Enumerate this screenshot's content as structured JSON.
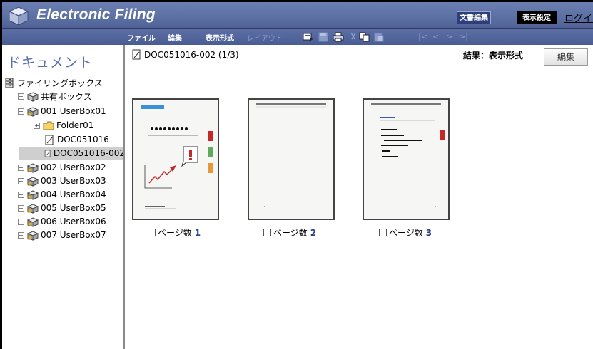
{
  "header": {
    "title": "Electronic Filing",
    "edit_doc_button": "文書編集",
    "view_settings_button": "表示設定",
    "login_link": "ログイン"
  },
  "menu": {
    "file": "ファイル",
    "edit": "編集",
    "display_format": "表示形式",
    "layout": "レイアウト"
  },
  "sidebar": {
    "title": "ドキュメント",
    "root": "ファイリングボックス",
    "shared_box": "共有ボックス",
    "box01": "001 UserBox01",
    "folder01": "Folder01",
    "doc1": "DOC051016",
    "doc2": "DOC051016-002",
    "box02": "002 UserBox02",
    "box03": "003 UserBox03",
    "box04": "004 UserBox04",
    "box05": "005 UserBox05",
    "box06": "006 UserBox06",
    "box07": "007 UserBox07"
  },
  "main": {
    "doc_title": "DOC051016-002  (1/3)",
    "result_label": "結果：表示形式",
    "edit_button": "編集",
    "pages": [
      {
        "label": "ページ数",
        "num": "1"
      },
      {
        "label": "ページ数",
        "num": "2"
      },
      {
        "label": "ページ数",
        "num": "3"
      }
    ]
  },
  "colors": {
    "header_bg": "#5c6fa3",
    "title_text": "#5a6fb0",
    "page_number": "#2a3f8a",
    "red_tab": "#c62828",
    "green_tab": "#5faa5f",
    "orange_tab": "#e8963a",
    "blue_bar": "#3a8fd8"
  }
}
